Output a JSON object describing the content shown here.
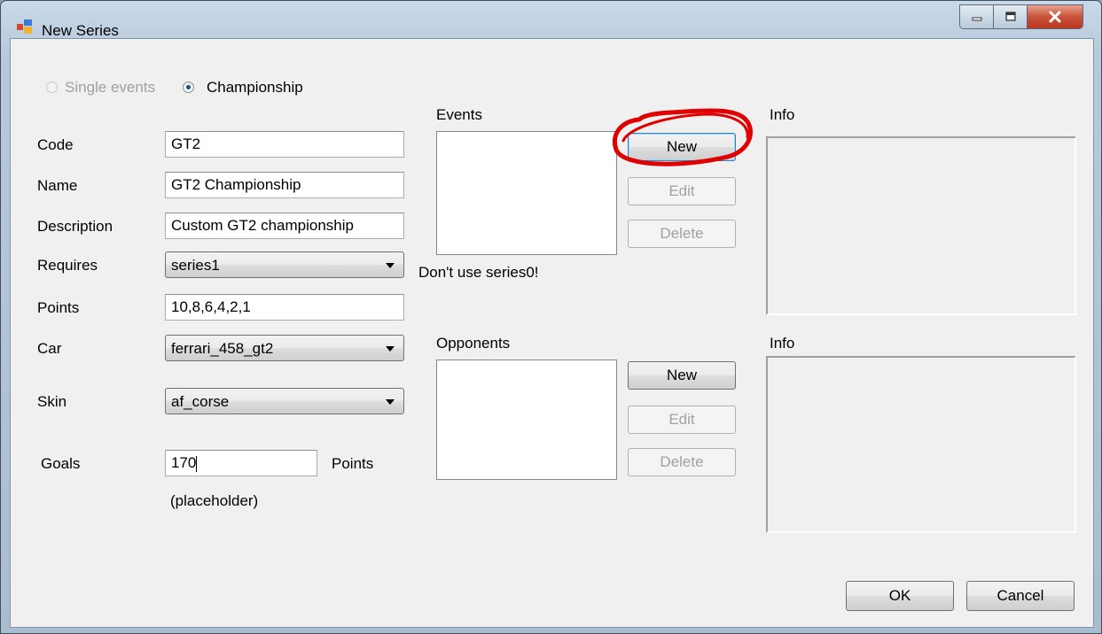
{
  "window": {
    "title": "New Series",
    "caption_buttons": [
      "minimize-icon",
      "maximize-icon",
      "close-icon"
    ]
  },
  "mode": {
    "single_events_label": "Single events",
    "championship_label": "Championship",
    "selected": "Championship"
  },
  "form": {
    "code_label": "Code",
    "code_value": "GT2",
    "name_label": "Name",
    "name_value": "GT2 Championship",
    "description_label": "Description",
    "description_value": "Custom GT2 championship",
    "requires_label": "Requires",
    "requires_value": "series1",
    "points_label": "Points",
    "points_value": "10,8,6,4,2,1",
    "car_label": "Car",
    "car_value": "ferrari_458_gt2",
    "skin_label": "Skin",
    "skin_value": "af_corse",
    "goals_label": "Goals",
    "goals_value": "170",
    "goals_unit": "Points",
    "goals_placeholder_note": "(placeholder)"
  },
  "events": {
    "label": "Events",
    "new_label": "New",
    "edit_label": "Edit",
    "delete_label": "Delete",
    "warning": "Don't use series0!"
  },
  "opponents": {
    "label": "Opponents",
    "new_label": "New",
    "edit_label": "Edit",
    "delete_label": "Delete"
  },
  "info": {
    "events_info_label": "Info",
    "opponents_info_label": "Info"
  },
  "footer": {
    "ok_label": "OK",
    "cancel_label": "Cancel"
  },
  "annotation": {
    "color": "#e00000",
    "target": "events-new-button"
  }
}
